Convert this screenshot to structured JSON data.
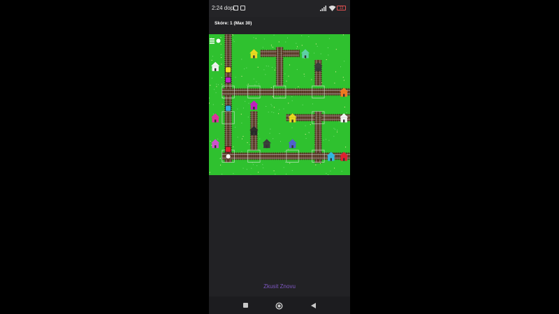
{
  "status": {
    "time": "2:24 dop.",
    "battery": "13"
  },
  "game": {
    "score_text": "Skóre: 1 (Max 30)",
    "retry_label": "Zkusit Znovu"
  },
  "nav": {
    "back_icon": "back-triangle-icon",
    "home_icon": "home-circle-icon",
    "recents_icon": "recents-square-icon"
  },
  "colors": {
    "grass": "#2fc12f",
    "track": "#6f4a35",
    "tie": "#4a2f20",
    "accent": "#7e57c2"
  },
  "houses": [
    {
      "name": "house-yellow",
      "color": "#e8d81f"
    },
    {
      "name": "house-teal",
      "color": "#5fd0a8"
    },
    {
      "name": "house-white",
      "color": "#f2f2f2"
    },
    {
      "name": "house-dark",
      "color": "#3a3a3a"
    },
    {
      "name": "house-orange",
      "color": "#f07a20"
    },
    {
      "name": "house-magenta",
      "color": "#c020c0"
    },
    {
      "name": "house-pink",
      "color": "#e030a0"
    },
    {
      "name": "house-yellow-2",
      "color": "#e8d81f"
    },
    {
      "name": "house-white-2",
      "color": "#f2f2f2"
    },
    {
      "name": "house-black",
      "color": "#2a2a2a"
    },
    {
      "name": "house-purple",
      "color": "#d050d0"
    },
    {
      "name": "house-indigo",
      "color": "#5060d0"
    },
    {
      "name": "house-red",
      "color": "#e02030"
    },
    {
      "name": "house-dark-2",
      "color": "#3a3a3a"
    },
    {
      "name": "house-cyan",
      "color": "#30b8e0"
    }
  ],
  "trains": [
    {
      "name": "train-yellow",
      "color": "#f0e020"
    },
    {
      "name": "train-magenta",
      "color": "#c020c0"
    },
    {
      "name": "train-cyan",
      "color": "#30a8e0"
    },
    {
      "name": "train-red",
      "color": "#e02030"
    }
  ]
}
